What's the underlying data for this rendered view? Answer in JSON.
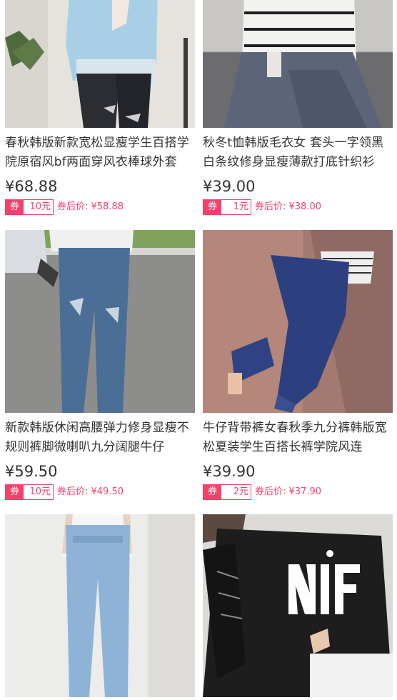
{
  "products": [
    {
      "title": "春秋韩版新款宽松显瘦学生百搭学院原宿风bf两面穿风衣棒球外套",
      "price": "¥68.88",
      "coupon_label": "券",
      "coupon_amount": "10元",
      "after_coupon": "券后价: ¥58.88",
      "image_icon": "jacket-photo"
    },
    {
      "title": "秋冬t恤韩版毛衣女 套头一字领黑白条纹修身显瘦薄款打底针织衫",
      "price": "¥39.00",
      "coupon_label": "券",
      "coupon_amount": "1元",
      "after_coupon": "券后价: ¥38.00",
      "image_icon": "striped-sweater-photo"
    },
    {
      "title": "新款韩版休闲高腰弹力修身显瘦不规则裤脚微喇叭九分阔腿牛仔",
      "price": "¥59.50",
      "coupon_label": "券",
      "coupon_amount": "10元",
      "after_coupon": "券后价: ¥49.50",
      "image_icon": "jeans-photo"
    },
    {
      "title": "牛仔背带裤女春秋季九分裤韩版宽松夏装学生百搭长裤学院风连",
      "price": "¥39.90",
      "coupon_label": "券",
      "coupon_amount": "2元",
      "after_coupon": "券后价: ¥37.90",
      "image_icon": "overalls-photo"
    },
    {
      "title": "",
      "price": "",
      "coupon_label": "",
      "coupon_amount": "",
      "after_coupon": "",
      "image_icon": "light-jeans-photo"
    },
    {
      "title": "",
      "price": "",
      "coupon_label": "",
      "coupon_amount": "",
      "after_coupon": "",
      "image_icon": "black-tshirt-photo"
    }
  ],
  "colors": {
    "accent": "#f2416b",
    "text": "#333333",
    "background": "#ffffff"
  }
}
